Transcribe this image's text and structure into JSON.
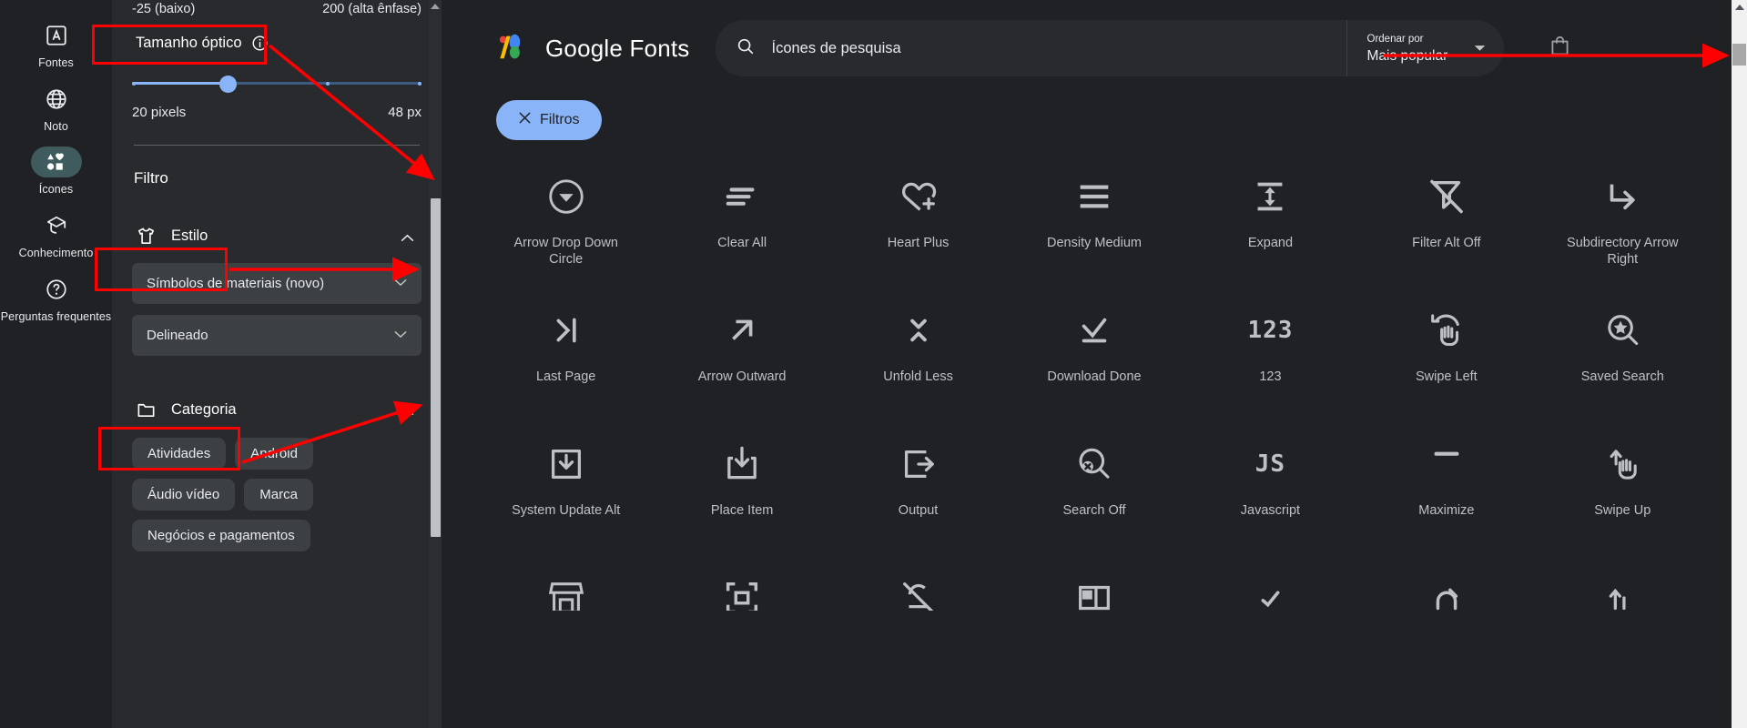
{
  "rail": {
    "items": [
      {
        "label": "Fontes",
        "icon": "letter-a-box-icon",
        "active": false
      },
      {
        "label": "Noto",
        "icon": "globe-icon",
        "active": false
      },
      {
        "label": "Ícones",
        "icon": "shapes-icon",
        "active": true
      },
      {
        "label": "Conhecimento",
        "icon": "graduation-cap-icon",
        "active": false
      },
      {
        "label": "Perguntas frequentes",
        "icon": "question-mark-circle-icon",
        "active": false
      }
    ]
  },
  "panel": {
    "axis_min": "-25 (baixo)",
    "axis_max": "200 (alta ênfase)",
    "optical_size": {
      "title": "Tamanho óptico",
      "info_icon": "info-circle-icon",
      "value_label": "20 pixels",
      "max_label": "48 px",
      "value": 20,
      "min": 20,
      "max": 48,
      "knob_percent": 33
    },
    "filter_heading": "Filtro",
    "style": {
      "title": "Estilo",
      "icon": "tshirt-icon",
      "collapse_icon": "chevron-up-icon",
      "family_select": "Símbolos de materiais (novo)",
      "fill_select": "Delineado",
      "select_chevron": "chevron-down-icon"
    },
    "category": {
      "title": "Categoria",
      "icon": "folder-icon",
      "collapse_icon": "chevron-up-icon",
      "chips": [
        "Atividades",
        "Android",
        "Áudio vídeo",
        "Marca",
        "Negócios e pagamentos"
      ]
    },
    "scrollbar": {
      "up_arrow_icon": "scroll-up-arrow-icon",
      "thumb": "panel-scroll-thumb"
    }
  },
  "header": {
    "brand": "Google Fonts",
    "brand_logo_icon": "google-fonts-logo-icon",
    "search": {
      "icon": "search-icon",
      "placeholder": "Ícones de pesquisa",
      "value": ""
    },
    "sort": {
      "label": "Ordenar por",
      "value": "Mais popular",
      "chevron_icon": "chevron-down-icon"
    },
    "bag_icon": "shopping-bag-icon"
  },
  "toolbar": {
    "filters_label": "Filtros",
    "filters_close_icon": "close-x-icon"
  },
  "grid": {
    "icons": [
      {
        "label": "Arrow Drop Down Circle",
        "icon": "arrow-drop-down-circle-icon"
      },
      {
        "label": "Clear All",
        "icon": "clear-all-icon"
      },
      {
        "label": "Heart Plus",
        "icon": "heart-plus-icon"
      },
      {
        "label": "Density Medium",
        "icon": "density-medium-icon"
      },
      {
        "label": "Expand",
        "icon": "expand-icon"
      },
      {
        "label": "Filter Alt Off",
        "icon": "filter-alt-off-icon"
      },
      {
        "label": "Subdirectory Arrow Right",
        "icon": "subdirectory-arrow-right-icon"
      },
      {
        "label": "Last Page",
        "icon": "last-page-icon"
      },
      {
        "label": "Arrow Outward",
        "icon": "arrow-outward-icon"
      },
      {
        "label": "Unfold Less",
        "icon": "unfold-less-icon"
      },
      {
        "label": "Download Done",
        "icon": "download-done-icon"
      },
      {
        "label": "123",
        "icon": "123-icon",
        "glyph": "123"
      },
      {
        "label": "Swipe Left",
        "icon": "swipe-left-icon"
      },
      {
        "label": "Saved Search",
        "icon": "saved-search-icon"
      },
      {
        "label": "System Update Alt",
        "icon": "system-update-alt-icon"
      },
      {
        "label": "Place Item",
        "icon": "place-item-icon"
      },
      {
        "label": "Output",
        "icon": "output-icon"
      },
      {
        "label": "Search Off",
        "icon": "search-off-icon"
      },
      {
        "label": "Javascript",
        "icon": "javascript-icon",
        "glyph": "JS"
      },
      {
        "label": "Maximize",
        "icon": "maximize-icon"
      },
      {
        "label": "Swipe Up",
        "icon": "swipe-up-icon"
      }
    ]
  },
  "window_scrollbar": {
    "up_arrow_icon": "scroll-up-arrow-icon",
    "thumb": "window-scroll-thumb"
  },
  "colors": {
    "bg": "#202124",
    "panel_bg": "#282a2d",
    "accent_blue": "#8ab4f8",
    "chip_bg": "#3c4043",
    "annotation_red": "#ff0000",
    "active_pill": "#3f5b5e"
  }
}
